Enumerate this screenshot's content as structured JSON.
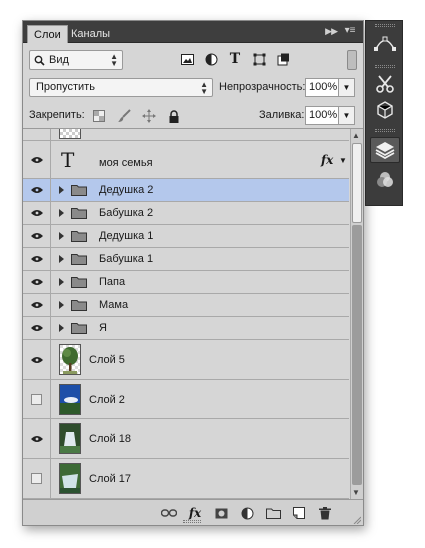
{
  "tabs": [
    {
      "label": "Слои",
      "active": true
    },
    {
      "label": "Каналы",
      "active": false
    }
  ],
  "filter": {
    "kind_label": "Вид",
    "kind_icon": "search-icon"
  },
  "blend": {
    "mode": "Пропустить",
    "opacity_label": "Непрозрачность:",
    "opacity_value": "100%"
  },
  "lock": {
    "label": "Закрепить:",
    "fill_label": "Заливка:",
    "fill_value": "100%"
  },
  "layers": [
    {
      "name": "",
      "type": "partial",
      "visible": false
    },
    {
      "name": "моя семья",
      "type": "text",
      "visible": true,
      "fx": "fx"
    },
    {
      "name": "Дедушка 2",
      "type": "group",
      "visible": true,
      "selected": true
    },
    {
      "name": "Бабушка 2",
      "type": "group",
      "visible": true
    },
    {
      "name": "Дедушка 1",
      "type": "group",
      "visible": true
    },
    {
      "name": "Бабушка 1",
      "type": "group",
      "visible": true
    },
    {
      "name": "Папа",
      "type": "group",
      "visible": true
    },
    {
      "name": "Мама",
      "type": "group",
      "visible": true
    },
    {
      "name": "Я",
      "type": "group",
      "visible": true
    },
    {
      "name": "Слой 5",
      "type": "image",
      "visible": true,
      "thumb": "tree"
    },
    {
      "name": "Слой 2",
      "type": "image",
      "visible": false,
      "thumb": "sky"
    },
    {
      "name": "Слой 18",
      "type": "image",
      "visible": true,
      "thumb": "waterfall"
    },
    {
      "name": "Слой 17",
      "type": "image",
      "visible": false,
      "thumb": "waterfall2"
    }
  ],
  "bottom": {
    "fx_label": "fx"
  },
  "colors": {
    "selected": "#b4c8ec",
    "panel": "#d6d6d6",
    "tabbar": "#3e3e3e"
  }
}
